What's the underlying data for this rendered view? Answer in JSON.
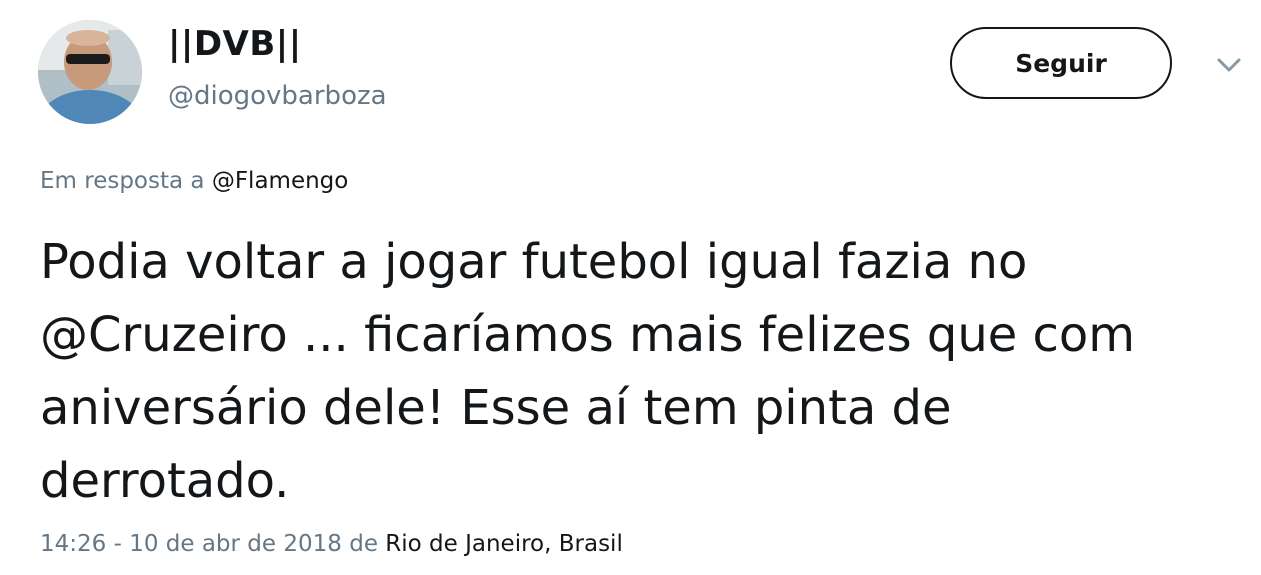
{
  "user": {
    "display_name": "||DVB||",
    "handle": "@diogovbarboza"
  },
  "follow_button": {
    "label": "Seguir"
  },
  "more_menu": {
    "icon": "chevron-down-icon"
  },
  "reply_context": {
    "prefix": "Em resposta a ",
    "mention": "@Flamengo"
  },
  "tweet": {
    "lines": [
      "Podia voltar a jogar futebol igual fazia no",
      "@Cruzeiro ... ficaríamos mais felizes que com",
      "aniversário dele! Esse aí tem pinta de",
      "derrotado."
    ]
  },
  "meta": {
    "timestamp": "14:26 - 10 de abr de 2018",
    "from_word": " de ",
    "location": "Rio de Janeiro, Brasil"
  },
  "colors": {
    "text_primary": "#14171a",
    "text_secondary": "#657786"
  }
}
